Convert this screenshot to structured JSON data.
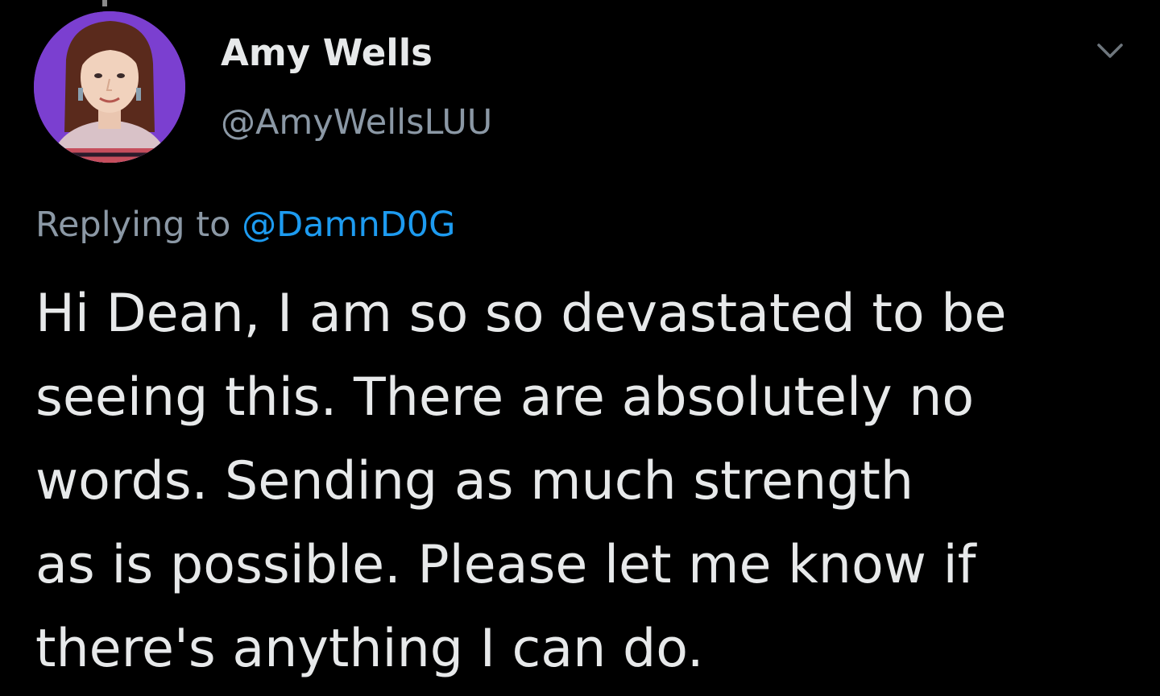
{
  "tweet": {
    "author": {
      "display_name": "Amy Wells",
      "handle": "@AmyWellsLUU",
      "avatar_icon": "profile-photo",
      "avatar_bg": "#7b3fd0"
    },
    "menu_icon": "chevron-down-icon",
    "reply": {
      "prefix": "Replying to",
      "mention": "@DamnD0G"
    },
    "text_lines": [
      "Hi Dean, I am so so devastated to be",
      "seeing this. There are absolutely no",
      "words. Sending as much strength",
      "as is possible. Please let me know if",
      "there's anything I can do."
    ]
  },
  "colors": {
    "background": "#000000",
    "primary_text": "#e7e9ea",
    "secondary_text": "#8b98a5",
    "link": "#1d9bf0"
  }
}
